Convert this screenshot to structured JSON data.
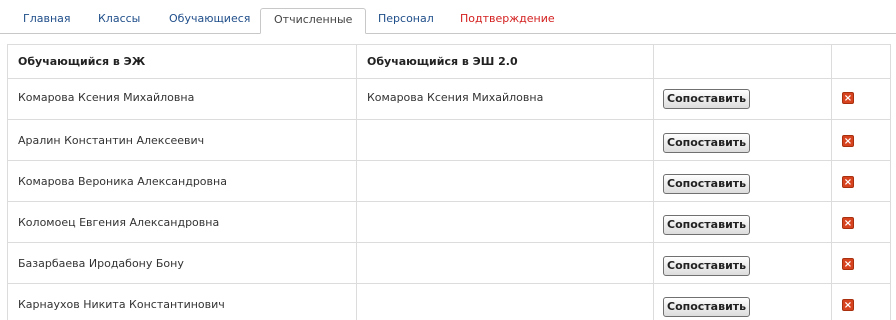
{
  "tabs": [
    {
      "label": "Главная",
      "state": "link"
    },
    {
      "label": "Классы",
      "state": "link"
    },
    {
      "label": "Обучающиеся",
      "state": "link"
    },
    {
      "label": "Отчисленные",
      "state": "active"
    },
    {
      "label": "Персонал",
      "state": "link"
    },
    {
      "label": "Подтверждение",
      "state": "alert"
    }
  ],
  "colors": {
    "tab_link": "#1f4e8a",
    "tab_alert": "#d42020",
    "delete_icon": "#d8431f",
    "border": "#dcdcdc"
  },
  "table": {
    "headers": [
      "Обучающийся в ЭЖ",
      "Обучающийся в ЭШ 2.0",
      "",
      ""
    ],
    "button_label": "Сопоставить",
    "delete_icon": "close-icon",
    "rows": [
      {
        "ej": "Комарова Ксения Михайловна",
        "esh": "Комарова Ксения Михайловна"
      },
      {
        "ej": "Аралин Константин Алексеевич",
        "esh": ""
      },
      {
        "ej": "Комарова Вероника Александровна",
        "esh": ""
      },
      {
        "ej": "Коломоец Евгения Александровна",
        "esh": ""
      },
      {
        "ej": "Базарбаева Иродабону Бону",
        "esh": ""
      },
      {
        "ej": "Карнаухов Никита Константинович",
        "esh": ""
      }
    ]
  }
}
